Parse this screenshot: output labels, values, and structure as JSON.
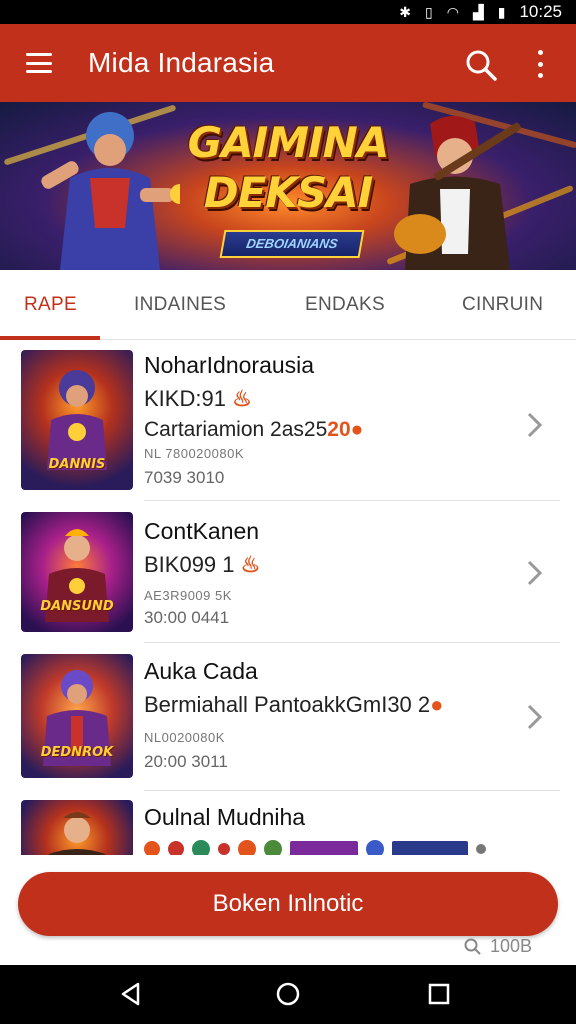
{
  "status_bar": {
    "time": "10:25"
  },
  "app_bar": {
    "title": "Mida Indarasia"
  },
  "banner": {
    "title_line1": "GAIMINA",
    "title_line2": "DEKSAI",
    "subtitle": "DEBOIANIANS"
  },
  "tabs": [
    {
      "label": "RAPE",
      "active": true
    },
    {
      "label": "INDAINES",
      "active": false
    },
    {
      "label": "ENDAKS",
      "active": false
    },
    {
      "label": "CINRUIN",
      "active": false
    }
  ],
  "items": [
    {
      "title": "NoharIdnorausia",
      "line2": "KIKD:91",
      "line3": "Cartariamion 2as25",
      "line3_badge": "20",
      "meta1": "NL 780020080K",
      "meta2": "7039 3010",
      "thumb_label": "DANNIS"
    },
    {
      "title": "ContKanen",
      "line2": "BIK099 1",
      "meta1": "AE3R9009 5K",
      "meta2": "30:00 0441",
      "thumb_label": "DANSUND"
    },
    {
      "title": "Auka Cada",
      "line2": "Bermiahall PantoakkGmI30 2",
      "meta1": "NL0020080K",
      "meta2": "20:00 3011",
      "thumb_label": "DEDNROK"
    },
    {
      "title": "Oulnal Mudniha"
    }
  ],
  "cta": {
    "label": "Boken Inlnotic"
  },
  "zoom": {
    "label": "100B"
  },
  "colors": {
    "primary": "#c0301b",
    "accent": "#e2541c"
  }
}
